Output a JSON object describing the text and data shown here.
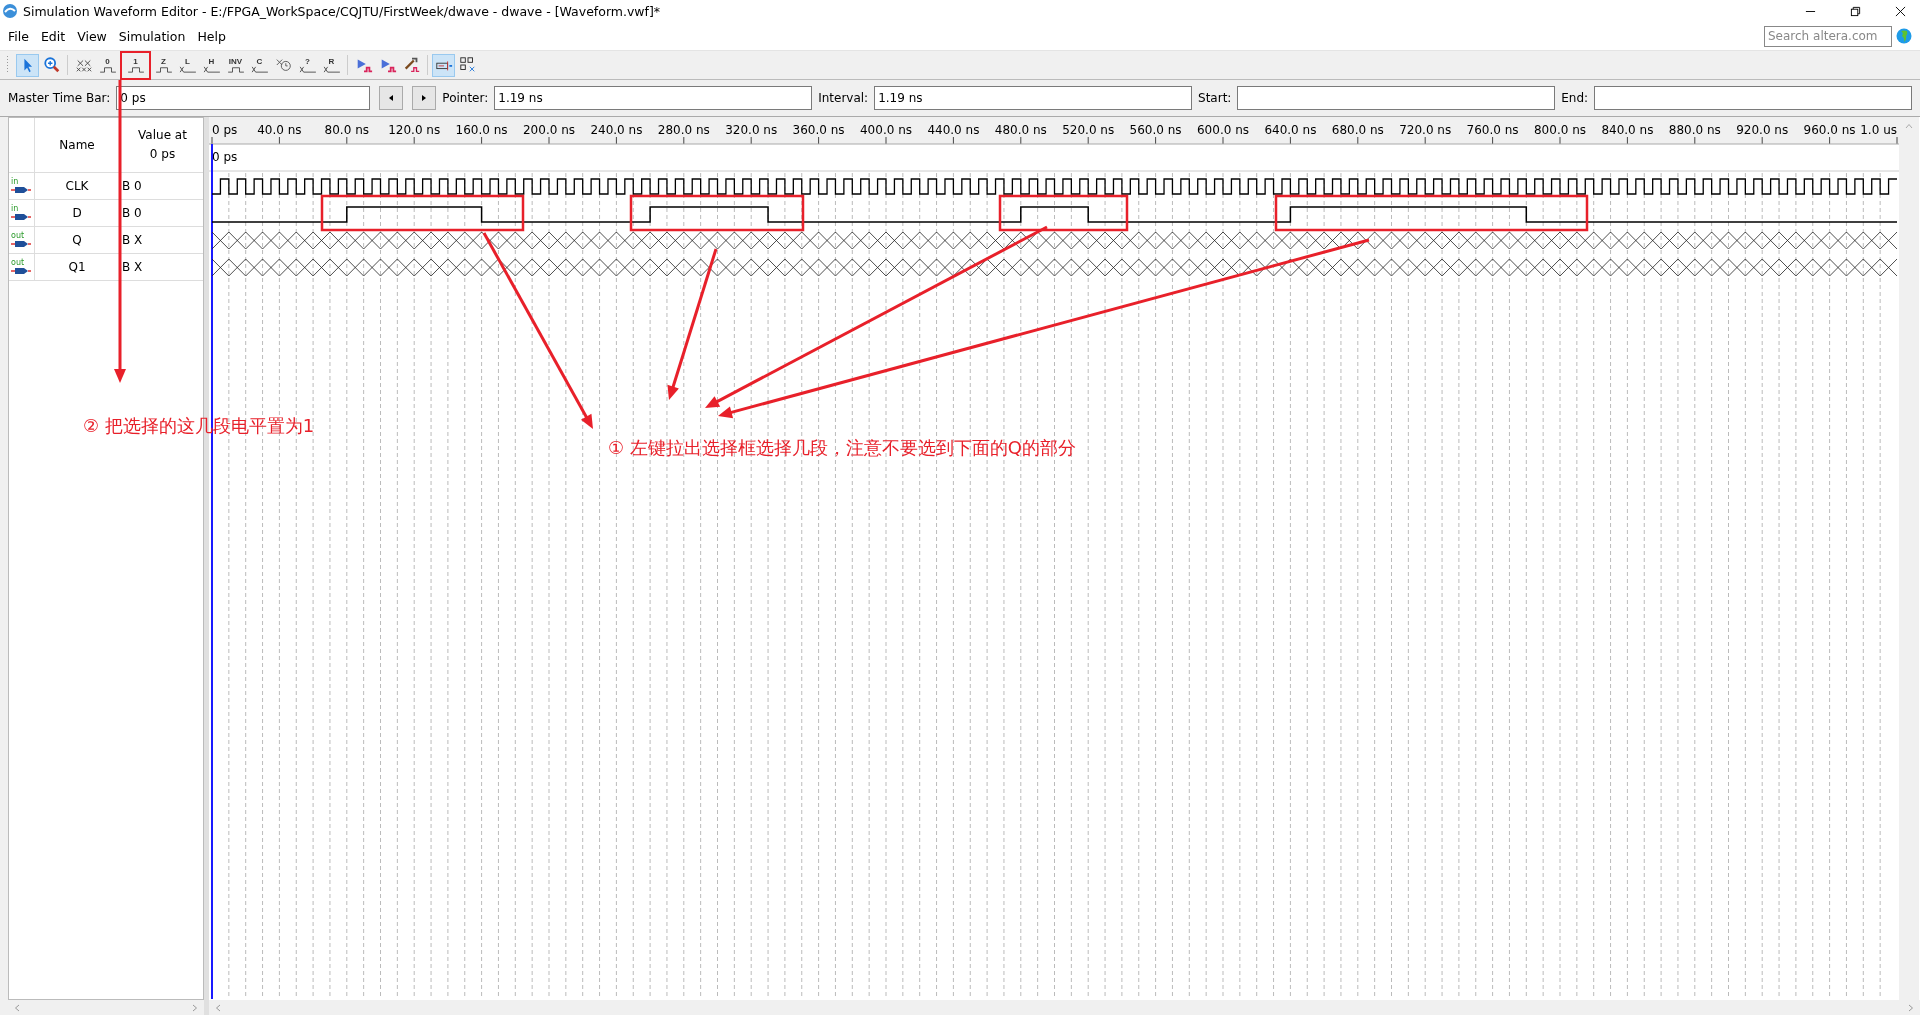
{
  "window": {
    "title": "Simulation Waveform Editor - E:/FPGA_WorkSpace/CQJTU/FirstWeek/dwave - dwave - [Waveform.vwf]*"
  },
  "menu": [
    "File",
    "Edit",
    "View",
    "Simulation",
    "Help"
  ],
  "search": {
    "placeholder": "Search altera.com"
  },
  "toolbar": [
    {
      "kind": "pointer",
      "selected": true
    },
    {
      "kind": "zoom",
      "selected": false
    },
    {
      "kind": "unknown",
      "selected": false
    },
    {
      "kind": "level",
      "glyph": "0",
      "selected": false
    },
    {
      "kind": "level",
      "glyph": "1",
      "selected": false
    },
    {
      "kind": "level",
      "glyph": "Z",
      "selected": false
    },
    {
      "kind": "bus",
      "glyph": "L",
      "selected": false
    },
    {
      "kind": "bus",
      "glyph": "H",
      "selected": false
    },
    {
      "kind": "level",
      "glyph": "INV",
      "selected": false
    },
    {
      "kind": "bus",
      "glyph": "C",
      "selected": false
    },
    {
      "kind": "clock",
      "selected": false
    },
    {
      "kind": "bus",
      "glyph": "?",
      "selected": false
    },
    {
      "kind": "bus",
      "glyph": "R",
      "selected": false
    },
    {
      "kind": "run",
      "selected": false
    },
    {
      "kind": "run",
      "selected": false
    },
    {
      "kind": "netlist",
      "selected": false
    },
    {
      "kind": "snap",
      "selected": true
    },
    {
      "kind": "grid",
      "selected": false
    }
  ],
  "time_bar": {
    "master": {
      "label": "Master Time Bar:",
      "value": "0 ps"
    },
    "pointer": {
      "label": "Pointer:",
      "value": "1.19 ns"
    },
    "interval": {
      "label": "Interval:",
      "value": "1.19 ns"
    },
    "start": {
      "label": "Start:"
    },
    "end": {
      "label": "End:"
    }
  },
  "table": {
    "columns": [
      "Name",
      "Value at 0 ps"
    ],
    "rows": [
      {
        "direction": "in",
        "name": "CLK",
        "value": "B 0",
        "kind": "clock"
      },
      {
        "direction": "in",
        "name": "D",
        "value": "B 0",
        "kind": "pulses"
      },
      {
        "direction": "out",
        "name": "Q",
        "value": "B X",
        "kind": "unknown"
      },
      {
        "direction": "out",
        "name": "Q1",
        "value": "B X",
        "kind": "unknown"
      }
    ]
  },
  "waveform": {
    "cursor_label": "0 ps",
    "ruler": [
      "0 ps",
      "40.0 ns",
      "80.0 ns",
      "120.0 ns",
      "160.0 ns",
      "200.0 ns",
      "240.0 ns",
      "280.0 ns",
      "320.0 ns",
      "360.0 ns",
      "400.0 ns",
      "440.0 ns",
      "480.0 ns",
      "520.0 ns",
      "560.0 ns",
      "600.0 ns",
      "640.0 ns",
      "680.0 ns",
      "720.0 ns",
      "760.0 ns",
      "800.0 ns",
      "840.0 ns",
      "880.0 ns",
      "920.0 ns",
      "960.0 ns",
      "1.0 us"
    ]
  },
  "annotations": [
    {
      "text": "② 把选择的这几段电平置为1"
    },
    {
      "text": "① 左键拉出选择框选择几段，注意不要选到下面的Q的部分"
    }
  ]
}
